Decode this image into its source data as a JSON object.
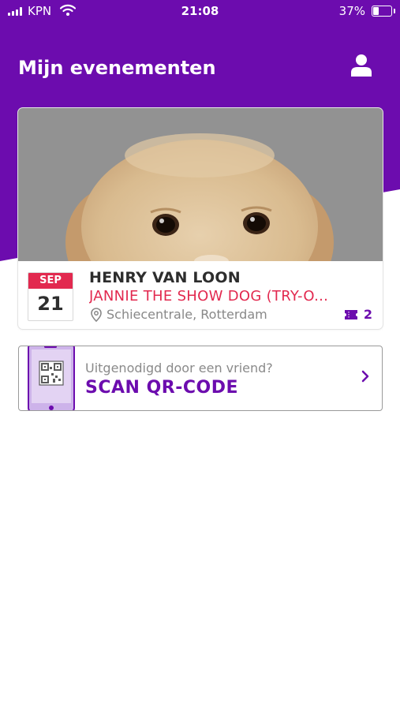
{
  "status_bar": {
    "carrier": "KPN",
    "time": "21:08",
    "battery_percent": "37%",
    "battery_level": 0.37
  },
  "header": {
    "title": "Mijn evenementen",
    "profile_icon": "user-icon"
  },
  "event": {
    "month": "SEP",
    "day": "21",
    "artist": "HENRY VAN LOON",
    "name": "JANNIE THE SHOW DOG (TRY-O...",
    "location": "Schiecentrale, Rotterdam",
    "ticket_count": "2",
    "location_icon": "map-pin-icon",
    "ticket_icon": "ticket-icon"
  },
  "scan": {
    "subtitle": "Uitgenodigd door een vriend?",
    "title": "SCAN QR-CODE",
    "chevron_icon": "chevron-right-icon"
  },
  "colors": {
    "brand_purple": "#6c0cae",
    "accent_red": "#e2294f"
  }
}
